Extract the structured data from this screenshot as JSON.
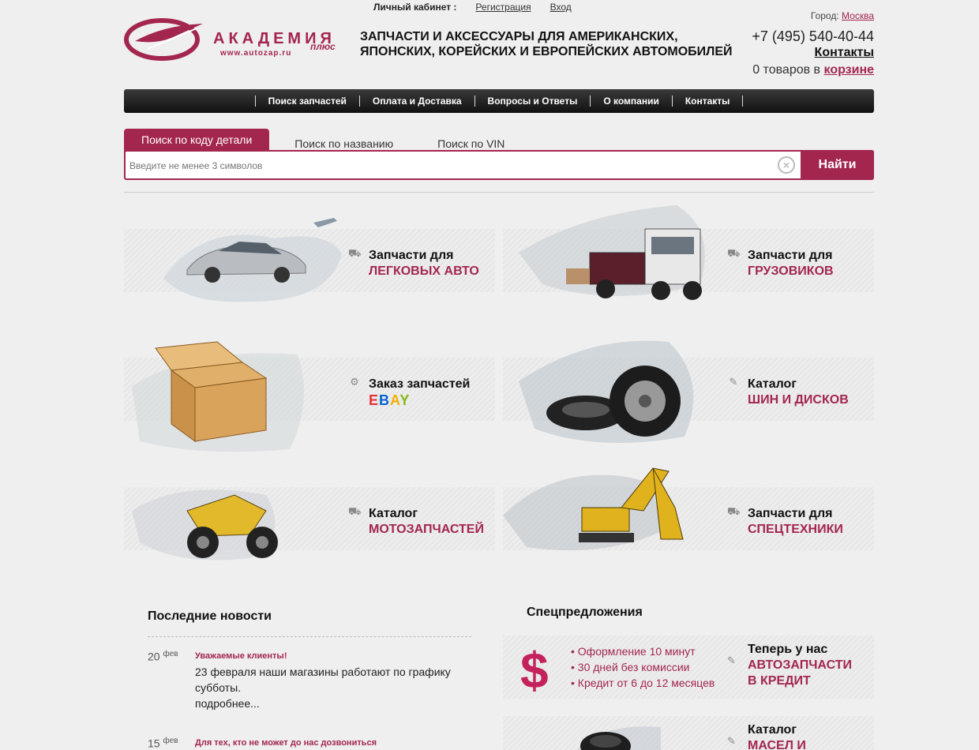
{
  "topbar": {
    "cabinet_label": "Личный кабинет :",
    "register": "Регистрация",
    "login": "Вход",
    "city_label": "Город:",
    "city": "Москва"
  },
  "header": {
    "logo_title": "АКАДЕМИЯ",
    "logo_plus": "плюс",
    "logo_url": "www.autozap.ru",
    "tagline_1": "ЗАПЧАСТИ И АКСЕССУАРЫ ДЛЯ АМЕРИКАНСКИХ,",
    "tagline_2": "ЯПОНСКИХ, КОРЕЙСКИХ И ЕВРОПЕЙСКИХ АВТОМОБИЛЕЙ",
    "phone": "+7 (495) 540-40-44",
    "contacts": "Контакты",
    "cart_prefix": "0 товаров в",
    "cart_link": "корзине"
  },
  "nav": {
    "items": [
      "Поиск запчастей",
      "Оплата и Доставка",
      "Вопросы и Ответы",
      "О компании",
      "Контакты"
    ]
  },
  "search": {
    "tabs": [
      "Поиск по коду детали",
      "Поиск по названию",
      "Поиск по VIN"
    ],
    "placeholder": "Введите не менее 3 символов",
    "button": "Найти"
  },
  "categories": [
    {
      "line1": "Запчасти для",
      "line2": "ЛЕГКОВЫХ АВТО",
      "icon": "car-icon"
    },
    {
      "line1": "Запчасти для",
      "line2": "ГРУЗОВИКОВ",
      "icon": "truck-icon"
    },
    {
      "line1": "Заказ запчастей",
      "line2": "EBAY",
      "icon": "gear-icon"
    },
    {
      "line1": "Каталог",
      "line2": "ШИН И ДИСКОВ",
      "icon": "edit-icon"
    },
    {
      "line1": "Каталог",
      "line2": "МОТОЗАПЧАСТЕЙ",
      "icon": "car-icon"
    },
    {
      "line1": "Запчасти для",
      "line2": "СПЕЦТЕХНИКИ",
      "icon": "truck-icon"
    }
  ],
  "ebay_colors": [
    "#e53238",
    "#0064d2",
    "#f5af02",
    "#86b817"
  ],
  "news": {
    "title": "Последние новости",
    "items": [
      {
        "day": "20",
        "month": "фев",
        "headline": "Уважаемые клиенты!",
        "text": "23 февраля наши магазины работают по графику субботы.",
        "more": "подробнее..."
      },
      {
        "day": "15",
        "month": "фев",
        "headline": "Для тех, кто не может до нас дозвониться"
      }
    ]
  },
  "specials": {
    "title": "Спецпредложения",
    "credit": {
      "bullets": [
        "Оформление 10 минут",
        "30 дней без комиссии",
        "Кредит от 6 до 12 месяцев"
      ],
      "line1": "Теперь у нас",
      "line2": "АВТОЗАПЧАСТИ",
      "line3": "В КРЕДИТ"
    },
    "oils": {
      "line1": "Каталог",
      "line2": "МАСЕЛ И"
    }
  },
  "colors": {
    "accent": "#a3264f",
    "nav_bg": "#1a1a1a"
  }
}
